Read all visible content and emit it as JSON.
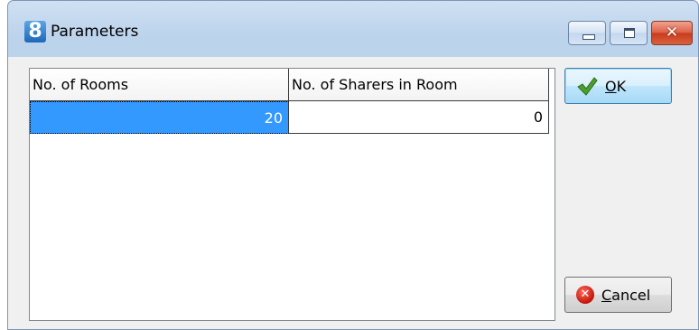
{
  "window": {
    "title": "Parameters",
    "icon_char": "8"
  },
  "grid": {
    "columns": [
      "No. of Rooms",
      "No. of Sharers in Room"
    ],
    "rows": [
      [
        "20",
        "0"
      ]
    ]
  },
  "buttons": {
    "ok_label": "OK",
    "cancel_label": "Cancel"
  },
  "colors": {
    "selection": "#3399ff",
    "ok_check": "#4aa02c",
    "cancel_circle": "#d9261a"
  },
  "icons": {
    "app": "app-logo-8-icon",
    "minimize": "minimize-icon",
    "maximize": "maximize-icon",
    "close": "close-icon",
    "ok": "green-check-icon",
    "cancel": "red-x-circle-icon"
  }
}
